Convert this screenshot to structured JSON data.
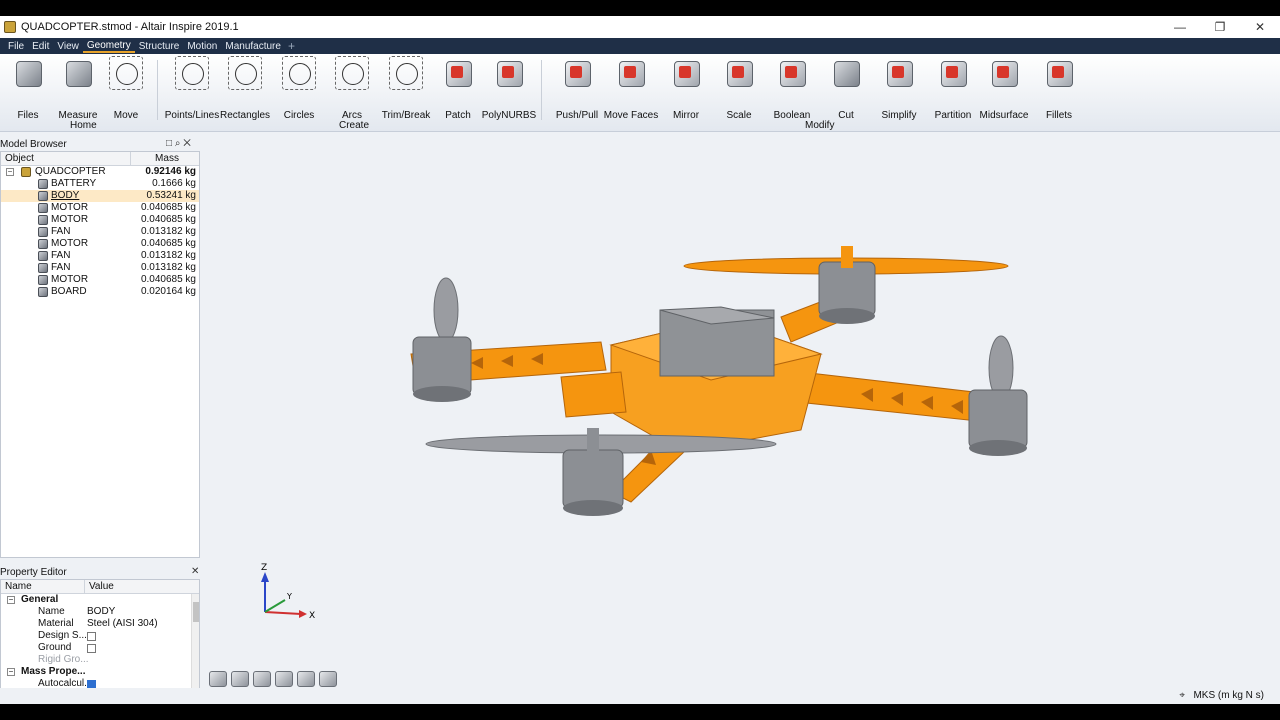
{
  "window": {
    "title": "QUADCOPTER.stmod - Altair Inspire 2019.1",
    "controls": [
      "—",
      "❐",
      "✕"
    ]
  },
  "menu": {
    "items": [
      "File",
      "Edit",
      "View",
      "Geometry",
      "Structure",
      "Motion",
      "Manufacture"
    ],
    "active": "Geometry",
    "add": "+"
  },
  "ribbon": {
    "tools": [
      {
        "label": "Files",
        "icon": "files-icon"
      },
      {
        "label": "Measure",
        "icon": "measure-icon"
      },
      {
        "label": "Move",
        "icon": "move-icon"
      },
      {
        "label": "Points/Lines",
        "icon": "points-lines-icon"
      },
      {
        "label": "Rectangles",
        "icon": "rectangles-icon"
      },
      {
        "label": "Circles",
        "icon": "circles-icon"
      },
      {
        "label": "Arcs",
        "icon": "arcs-icon"
      },
      {
        "label": "Trim/Break",
        "icon": "trim-break-icon"
      },
      {
        "label": "Patch",
        "icon": "patch-icon"
      },
      {
        "label": "PolyNURBS",
        "icon": "polynurbs-icon"
      },
      {
        "label": "Push/Pull",
        "icon": "push-pull-icon"
      },
      {
        "label": "Move Faces",
        "icon": "move-faces-icon"
      },
      {
        "label": "Mirror",
        "icon": "mirror-icon"
      },
      {
        "label": "Scale",
        "icon": "scale-icon"
      },
      {
        "label": "Boolean",
        "icon": "boolean-icon"
      },
      {
        "label": "Cut",
        "icon": "cut-icon"
      },
      {
        "label": "Simplify",
        "icon": "simplify-icon"
      },
      {
        "label": "Partition",
        "icon": "partition-icon"
      },
      {
        "label": "Midsurface",
        "icon": "midsurface-icon"
      },
      {
        "label": "Fillets",
        "icon": "fillets-icon"
      }
    ],
    "groups": [
      "Home",
      "Create",
      "Modify"
    ]
  },
  "model_browser": {
    "title": "Model Browser",
    "tools": "□ ⌕ ✕",
    "columns": [
      "Object",
      "Mass"
    ],
    "root": {
      "name": "QUADCOPTER",
      "mass": "0.92146 kg"
    },
    "parts": [
      {
        "name": "BATTERY",
        "mass": "0.1666 kg"
      },
      {
        "name": "BODY",
        "mass": "0.53241 kg",
        "selected": true
      },
      {
        "name": "MOTOR",
        "mass": "0.040685 kg"
      },
      {
        "name": "MOTOR",
        "mass": "0.040685 kg"
      },
      {
        "name": "FAN",
        "mass": "0.013182 kg"
      },
      {
        "name": "MOTOR",
        "mass": "0.040685 kg"
      },
      {
        "name": "FAN",
        "mass": "0.013182 kg"
      },
      {
        "name": "FAN",
        "mass": "0.013182 kg"
      },
      {
        "name": "MOTOR",
        "mass": "0.040685 kg"
      },
      {
        "name": "BOARD",
        "mass": "0.020164 kg"
      }
    ]
  },
  "property_editor": {
    "title": "Property Editor",
    "columns": [
      "Name",
      "Value"
    ],
    "general_group": "General",
    "rows": [
      {
        "key": "Name",
        "value": "BODY"
      },
      {
        "key": "Material",
        "value": "Steel (AISI 304)"
      },
      {
        "key": "Design S...",
        "checkbox": false
      },
      {
        "key": "Ground",
        "checkbox": false
      },
      {
        "key": "Rigid Gro...",
        "disabled": true
      }
    ],
    "mass_group": "Mass Prope...",
    "mass_rows": [
      {
        "key": "Autocalcul...",
        "checkbox": true
      }
    ]
  },
  "viewport": {
    "axes": {
      "z": "Z",
      "y": "Y",
      "x": "X"
    },
    "model_colors": {
      "frame": "#f5950f",
      "motor": "#8c8f94",
      "battery": "#9a9a9a"
    }
  },
  "status": {
    "units": "MKS (m kg N s)",
    "snap": "⌖"
  }
}
